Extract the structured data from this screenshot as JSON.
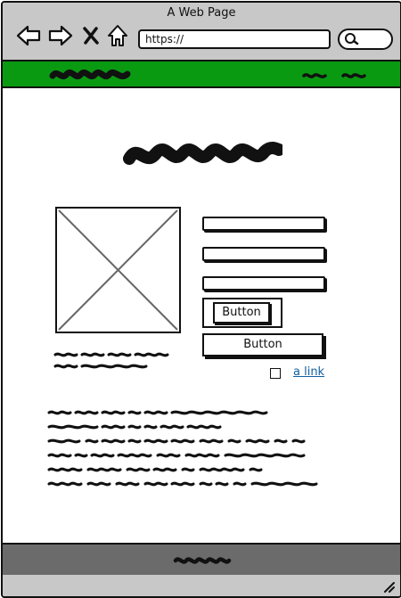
{
  "window": {
    "title": "A Web Page"
  },
  "toolbar": {
    "icons": [
      "back-arrow-icon",
      "forward-arrow-icon",
      "close-x-icon",
      "home-icon",
      "search-icon"
    ],
    "address": "https://"
  },
  "form": {
    "button_label": "Button",
    "wide_button_label": "Button",
    "link_label": "a link"
  },
  "colors": {
    "menubar": "#0a9a12",
    "chrome": "#c8c8c8",
    "footer": "#6b6b6b",
    "link": "#1060a0"
  }
}
